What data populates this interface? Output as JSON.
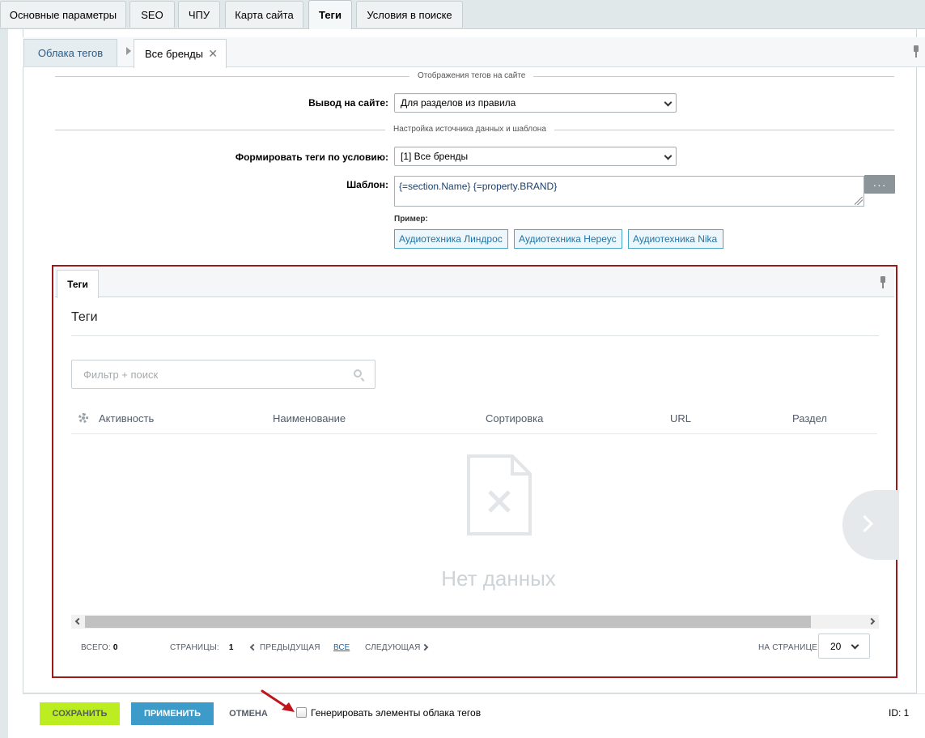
{
  "top_tabs": [
    {
      "label": "Основные параметры"
    },
    {
      "label": "SEO"
    },
    {
      "label": "ЧПУ"
    },
    {
      "label": "Карта сайта"
    },
    {
      "label": "Теги"
    },
    {
      "label": "Условия в поиске"
    }
  ],
  "sub_tabs": {
    "clouds": "Облака тегов",
    "brands": "Все бренды",
    "close": "✕"
  },
  "form": {
    "section1": "Отображения тегов на сайте",
    "output_label": "Вывод на сайте:",
    "output_value": "Для разделов из правила",
    "section2": "Настройка источника данных и шаблона",
    "condition_label": "Формировать теги по условию:",
    "condition_value": "[1] Все бренды",
    "template_label": "Шаблон:",
    "template_value": "{=section.Name} {=property.BRAND}",
    "dots": "···",
    "example_label": "Пример:",
    "examples": [
      "Аудиотехника Линдрос",
      "Аудиотехника Нереус",
      "Аудиотехника Nika"
    ]
  },
  "grid": {
    "tab": "Теги",
    "title": "Теги",
    "search_placeholder": "Фильтр + поиск",
    "columns": [
      "Активность",
      "Наименование",
      "Сортировка",
      "URL",
      "Раздел"
    ],
    "no_data": "Нет данных",
    "total_label": "ВСЕГО:",
    "total_value": "0",
    "pages_label": "СТРАНИЦЫ:",
    "pages_value": "1",
    "prev": "ПРЕДЫДУЩАЯ",
    "all": "ВСЕ",
    "next": "СЛЕДУЮЩАЯ",
    "per_page_label": "НА СТРАНИЦЕ:",
    "per_page_value": "20"
  },
  "bottom": {
    "save": "СОХРАНИТЬ",
    "apply": "ПРИМЕНИТЬ",
    "cancel": "ОТМЕНА",
    "generate_label": "Генерировать элементы облака тегов",
    "id_label": "ID: 1"
  },
  "colors": {
    "accent_save": "#bbed21",
    "accent_apply": "#3d9bc9",
    "highlight_frame": "#9e1a1a",
    "annotation_arrow": "#c0141b"
  }
}
